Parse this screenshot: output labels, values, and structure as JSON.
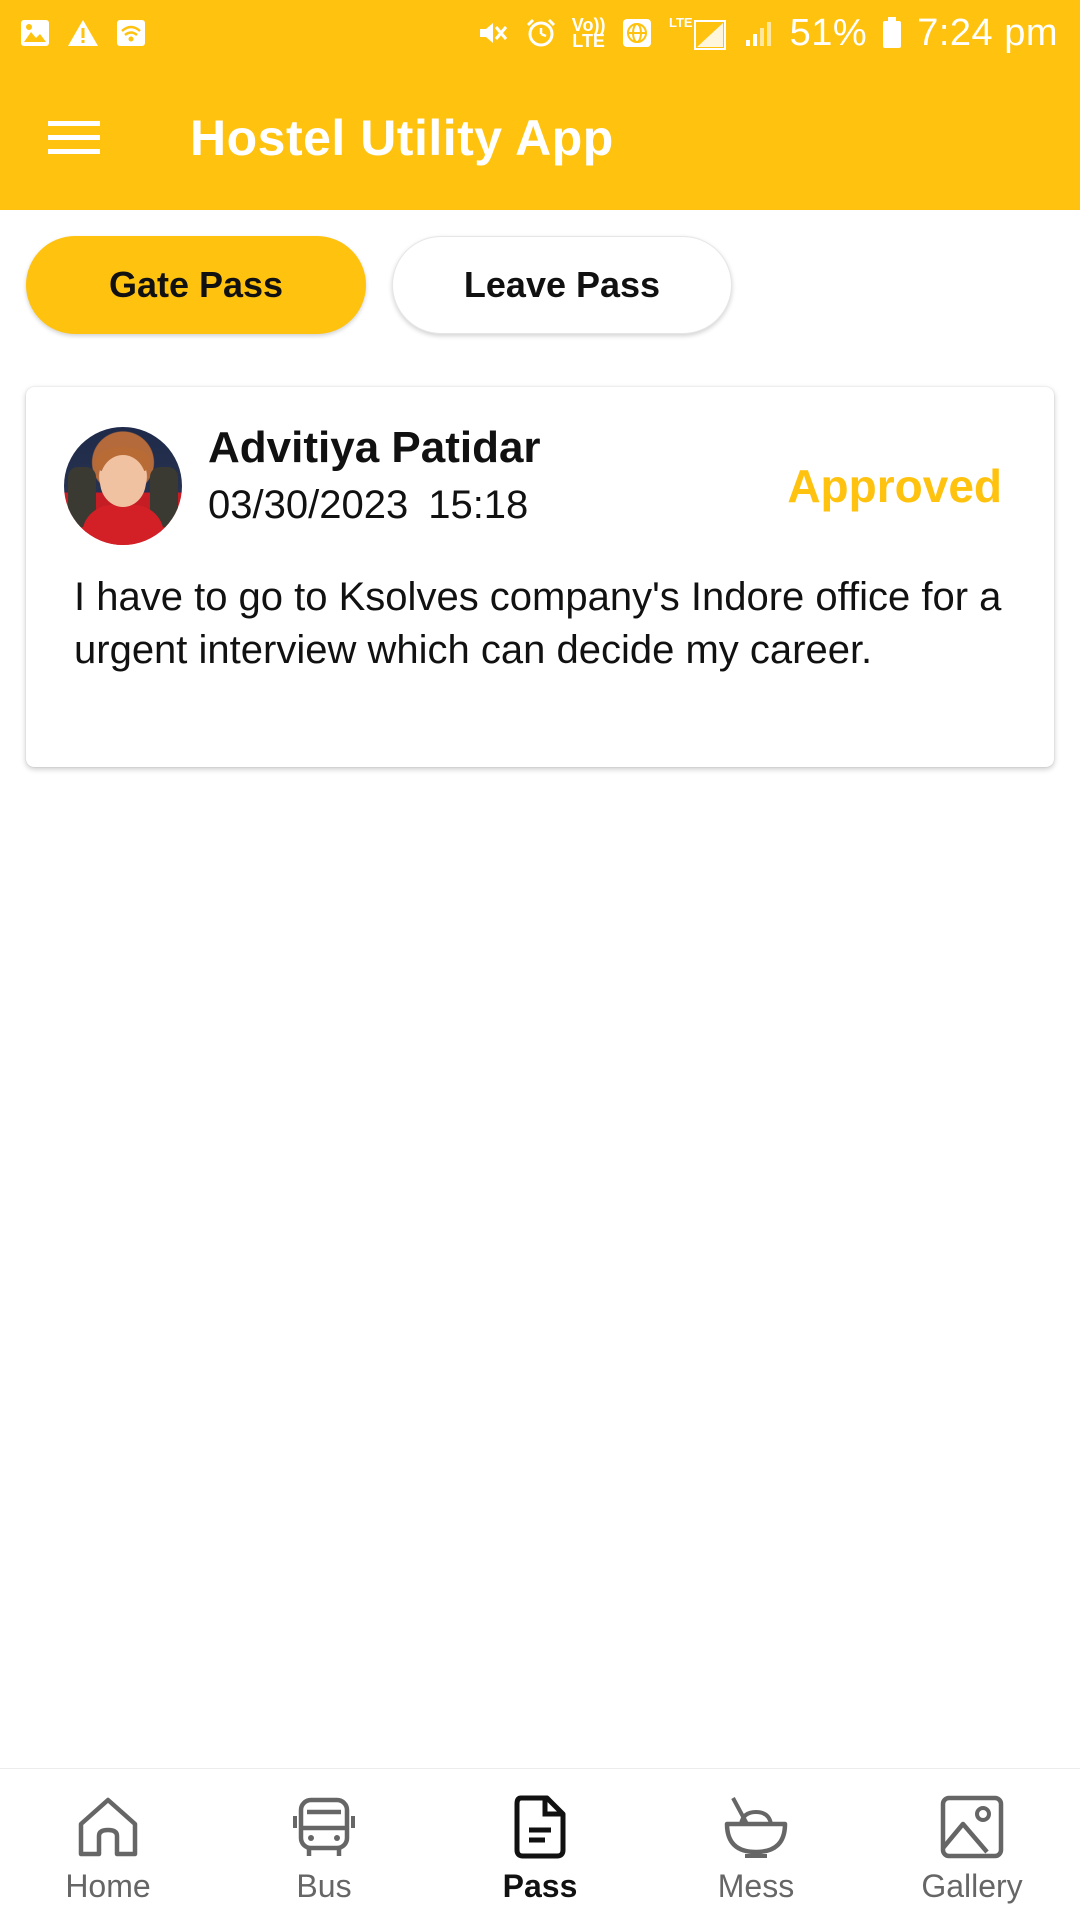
{
  "status_bar": {
    "icons_left": [
      "image-icon",
      "warning-icon",
      "wifi-icon"
    ],
    "icons_right": [
      "mute-icon",
      "alarm-icon",
      "volte-icon",
      "globe-icon",
      "lte-signal-icon",
      "signal-icon"
    ],
    "volte_label_top": "Vo))",
    "volte_label_bottom": "LTE",
    "battery": "51%",
    "time": "7:24 pm"
  },
  "app_bar": {
    "title": "Hostel Utility App",
    "menu_icon": "hamburger-menu-icon"
  },
  "tabs": [
    {
      "label": "Gate Pass",
      "active": true
    },
    {
      "label": "Leave Pass",
      "active": false
    }
  ],
  "pass_card": {
    "name": "Advitiya Patidar",
    "date": "03/30/2023",
    "time": "15:18",
    "status": "Approved",
    "reason": "I have to go to Ksolves company's Indore office for a urgent interview which can decide my career."
  },
  "bottom_nav": [
    {
      "label": "Home",
      "icon": "home-icon",
      "active": false
    },
    {
      "label": "Bus",
      "icon": "bus-icon",
      "active": false
    },
    {
      "label": "Pass",
      "icon": "document-icon",
      "active": true
    },
    {
      "label": "Mess",
      "icon": "food-bowl-icon",
      "active": false
    },
    {
      "label": "Gallery",
      "icon": "gallery-icon",
      "active": false
    }
  ],
  "colors": {
    "accent": "#FFC20E",
    "text": "#111111",
    "inactive_nav": "#666666"
  }
}
